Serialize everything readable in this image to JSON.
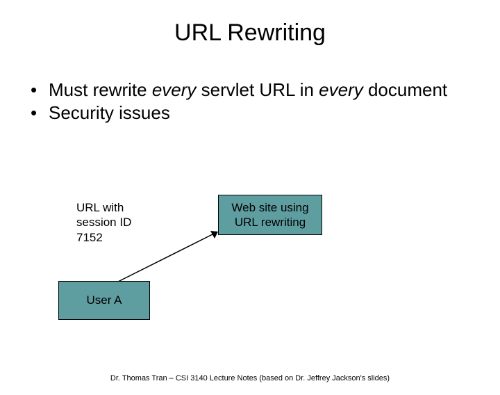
{
  "title": "URL Rewriting",
  "bullets": {
    "b1_pre": "Must rewrite ",
    "b1_em1": "every",
    "b1_mid": " servlet URL in ",
    "b1_em2": "every",
    "b1_post": " document",
    "b2": "Security issues"
  },
  "diagram": {
    "url_label": "URL with\nsession ID\n7152",
    "website_box": "Web site using\nURL rewriting",
    "user_box": "User A"
  },
  "footer": "Dr. Thomas Tran – CSI 3140 Lecture Notes (based on Dr. Jeffrey Jackson's slides)"
}
